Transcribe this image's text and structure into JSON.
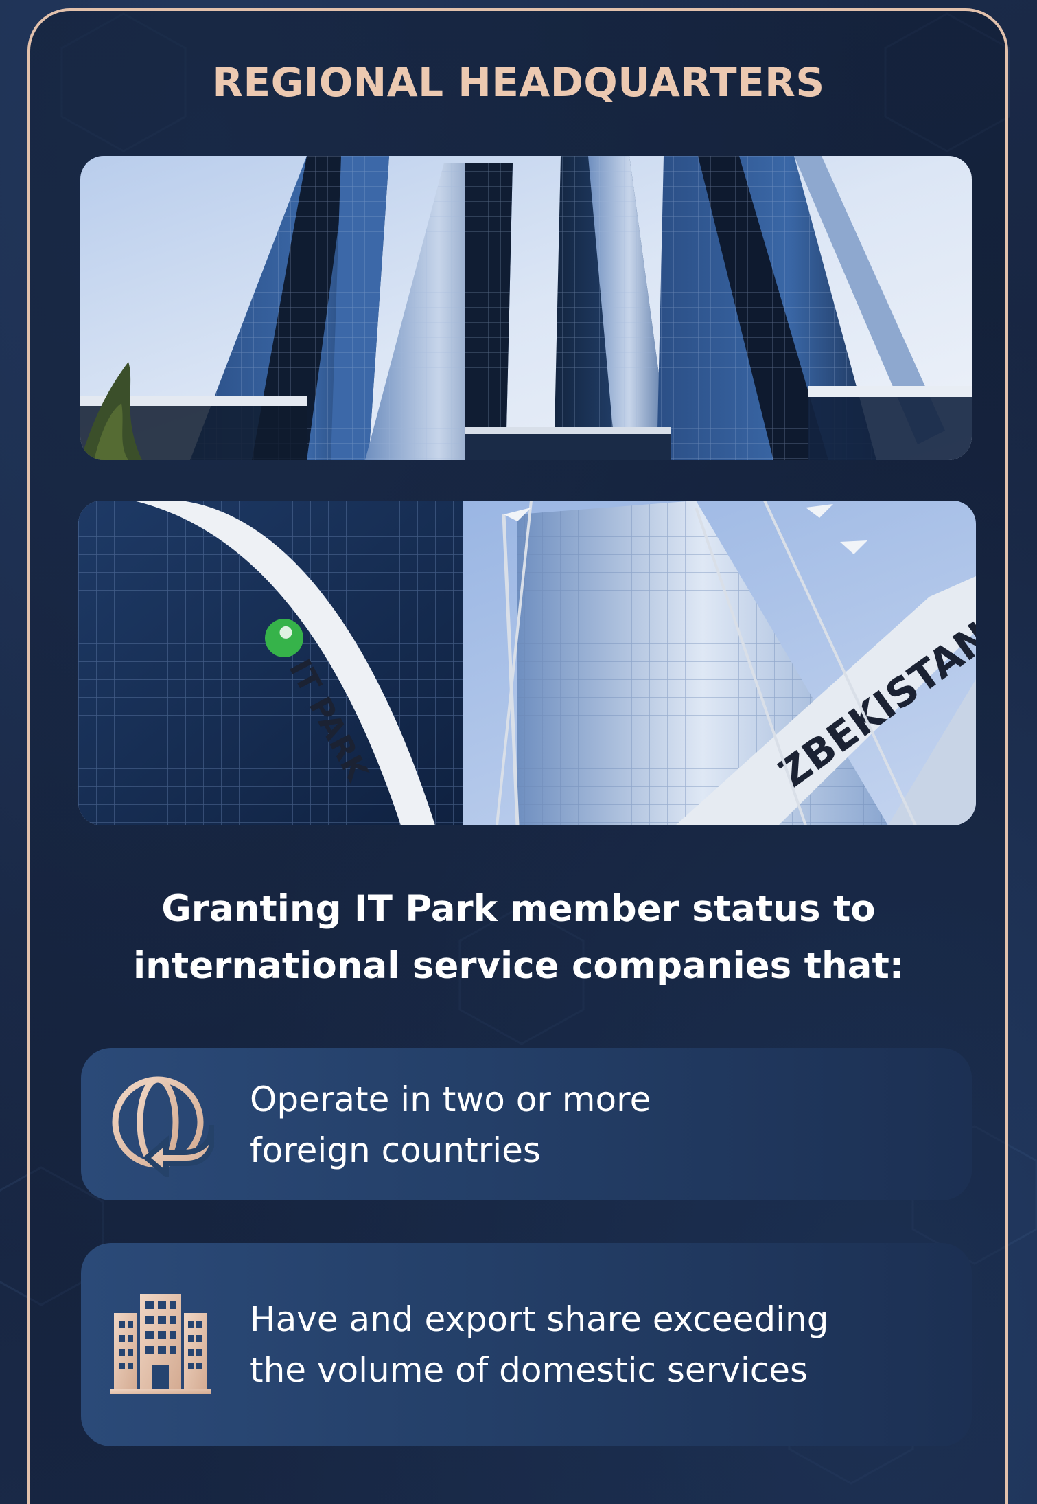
{
  "title": "REGIONAL HEADQUARTERS",
  "photos": {
    "top": {
      "subject": "glass skyscraper towers"
    },
    "bottom": {
      "subject": "IT Park building with flags",
      "sign_left": "IT PARK",
      "sign_right": "ZBEKISTAN"
    }
  },
  "heading": {
    "line1": "Granting IT Park member status to",
    "line2": "international service companies that:"
  },
  "criteria": [
    {
      "icon": "globe-arrow-icon",
      "line1": "Operate in two or more",
      "line2": "foreign countries"
    },
    {
      "icon": "office-building-icon",
      "line1": "Have and export share exceeding",
      "line2": "the volume of domestic services"
    }
  ],
  "colors": {
    "accent": "#e2c1ac",
    "background": "#1a2a48",
    "card": "#2b4a78",
    "text": "#ffffff"
  }
}
